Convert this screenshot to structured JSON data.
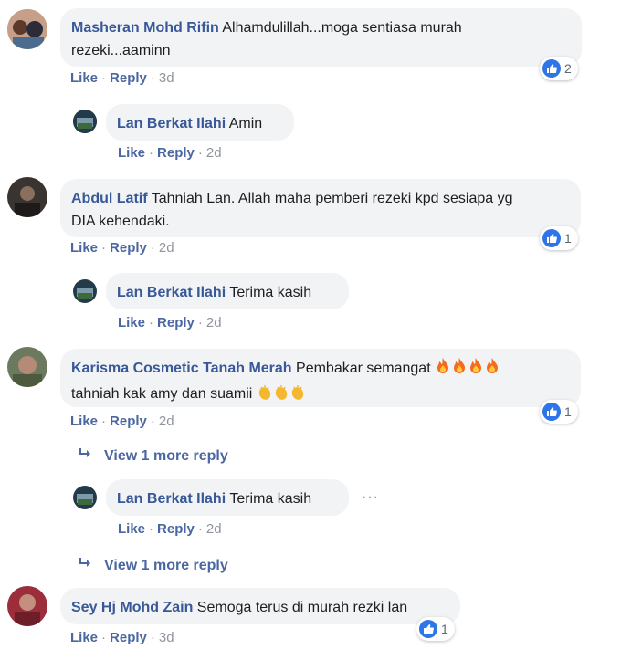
{
  "colors": {
    "name": "#385898",
    "link": "#4b67a1",
    "bubble": "#f2f3f5",
    "like_blue": "#2e76e8"
  },
  "comments": [
    {
      "author": "Masheran Mohd Rifin",
      "text_line1": "Alhamdulillah...moga sentiasa murah",
      "text_line2": "rezeki...aaminn",
      "like": "Like",
      "reply": "Reply",
      "time": "3d",
      "reactions": "2",
      "reply_item": {
        "author": "Lan Berkat Ilahi",
        "text": "Amin",
        "like": "Like",
        "reply": "Reply",
        "time": "2d"
      }
    },
    {
      "author": "Abdul Latif",
      "text_line1": "Tahniah Lan. Allah maha pemberi rezeki kpd sesiapa yg",
      "text_line2": "DIA kehendaki.",
      "like": "Like",
      "reply": "Reply",
      "time": "2d",
      "reactions": "1",
      "reply_item": {
        "author": "Lan Berkat Ilahi",
        "text": "Terima kasih",
        "like": "Like",
        "reply": "Reply",
        "time": "2d"
      }
    },
    {
      "author": "Karisma Cosmetic Tanah Merah",
      "text_line1": "Pembakar semangat",
      "text_line2": "tahniah kak amy dan suamii",
      "emoji_line1": [
        "fire-emoji",
        "fire-emoji",
        "fire-emoji",
        "fire-emoji"
      ],
      "emoji_line2": [
        "clap-emoji",
        "clap-emoji",
        "clap-emoji"
      ],
      "like": "Like",
      "reply": "Reply",
      "time": "2d",
      "reactions": "1",
      "view_more_1": "View 1 more reply",
      "reply_item": {
        "author": "Lan Berkat Ilahi",
        "text": "Terima kasih",
        "like": "Like",
        "reply": "Reply",
        "time": "2d",
        "more": "···"
      },
      "view_more_2": "View 1 more reply"
    },
    {
      "author": "Sey Hj Mohd Zain",
      "text_line1": "Semoga terus di murah rezki lan",
      "like": "Like",
      "reply": "Reply",
      "time": "3d",
      "reactions": "1"
    }
  ]
}
